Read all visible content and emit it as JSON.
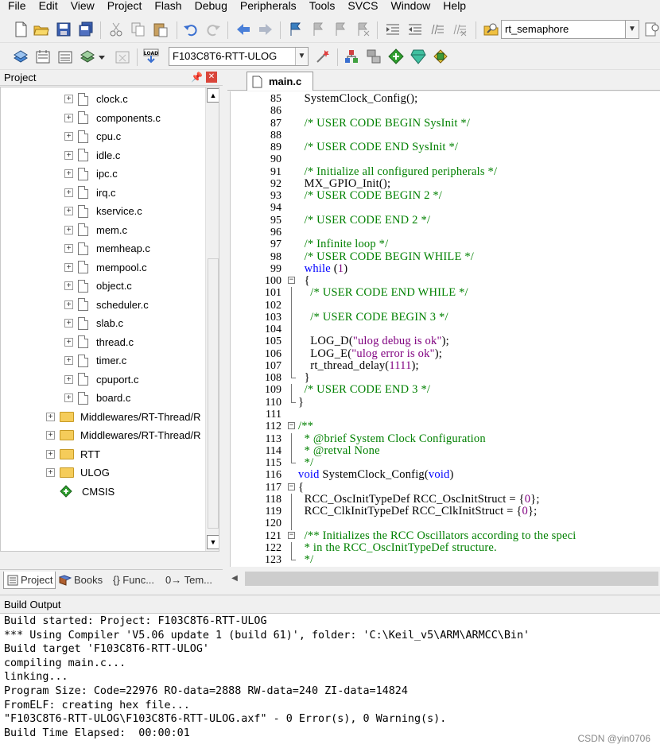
{
  "menu": [
    "File",
    "Edit",
    "View",
    "Project",
    "Flash",
    "Debug",
    "Peripherals",
    "Tools",
    "SVCS",
    "Window",
    "Help"
  ],
  "toolbar1": {
    "find_combo_value": "rt_semaphore",
    "icons": [
      "new-file-icon",
      "open-folder-icon",
      "save-icon",
      "save-all-icon",
      "cut-icon",
      "copy-icon",
      "paste-icon",
      "undo-icon",
      "redo-icon",
      "navigate-back-icon",
      "navigate-forward-icon",
      "bookmark-icon",
      "prev-bookmark-icon",
      "next-bookmark-icon",
      "clear-bookmarks-icon",
      "indent-icon",
      "unindent-icon",
      "comment-icon",
      "uncomment-icon",
      "find-in-files-icon"
    ]
  },
  "toolbar2": {
    "target_combo_value": "F103C8T6-RTT-ULOG",
    "icons": [
      "translate-icon",
      "build-icon",
      "rebuild-icon",
      "batch-build-icon",
      "stop-build-icon",
      "download-icon",
      "target-options-icon",
      "manage-components-icon",
      "select-packs-icon",
      "pack-installer-icon",
      "event-recorder-icon",
      "pack-manager-icon"
    ]
  },
  "project_panel": {
    "title": "Project",
    "files": [
      "clock.c",
      "components.c",
      "cpu.c",
      "idle.c",
      "ipc.c",
      "irq.c",
      "kservice.c",
      "mem.c",
      "memheap.c",
      "mempool.c",
      "object.c",
      "scheduler.c",
      "slab.c",
      "thread.c",
      "timer.c",
      "cpuport.c",
      "board.c"
    ],
    "groups": [
      "Middlewares/RT-Thread/R",
      "Middlewares/RT-Thread/R",
      "RTT",
      "ULOG"
    ],
    "cmsis": "CMSIS",
    "tabs": [
      "Project",
      "Books",
      "{} Func...",
      "0→ Tem..."
    ]
  },
  "editor": {
    "tab_label": "main.c",
    "lines": [
      {
        "n": "85",
        "fold": "",
        "segments": [
          {
            "t": "  SystemClock_Config();",
            "c": "plain"
          }
        ]
      },
      {
        "n": "86",
        "fold": "",
        "segments": []
      },
      {
        "n": "87",
        "fold": "",
        "segments": [
          {
            "t": "  /* USER CODE BEGIN SysInit */",
            "c": "comment"
          }
        ]
      },
      {
        "n": "88",
        "fold": "",
        "segments": []
      },
      {
        "n": "89",
        "fold": "",
        "segments": [
          {
            "t": "  /* USER CODE END SysInit */",
            "c": "comment"
          }
        ]
      },
      {
        "n": "90",
        "fold": "",
        "segments": []
      },
      {
        "n": "91",
        "fold": "",
        "segments": [
          {
            "t": "  /* Initialize all configured peripherals */",
            "c": "comment"
          }
        ]
      },
      {
        "n": "92",
        "fold": "",
        "segments": [
          {
            "t": "  MX_GPIO_Init();",
            "c": "plain"
          }
        ]
      },
      {
        "n": "93",
        "fold": "",
        "segments": [
          {
            "t": "  /* USER CODE BEGIN 2 */",
            "c": "comment"
          }
        ]
      },
      {
        "n": "94",
        "fold": "",
        "segments": []
      },
      {
        "n": "95",
        "fold": "",
        "segments": [
          {
            "t": "  /* USER CODE END 2 */",
            "c": "comment"
          }
        ]
      },
      {
        "n": "96",
        "fold": "",
        "segments": []
      },
      {
        "n": "97",
        "fold": "",
        "segments": [
          {
            "t": "  /* Infinite loop */",
            "c": "comment"
          }
        ]
      },
      {
        "n": "98",
        "fold": "",
        "segments": [
          {
            "t": "  /* USER CODE BEGIN WHILE */",
            "c": "comment"
          }
        ]
      },
      {
        "n": "99",
        "fold": "",
        "segments": [
          {
            "t": "  ",
            "c": "plain"
          },
          {
            "t": "while",
            "c": "keyword"
          },
          {
            "t": " (",
            "c": "plain"
          },
          {
            "t": "1",
            "c": "number"
          },
          {
            "t": ")",
            "c": "plain"
          }
        ]
      },
      {
        "n": "100",
        "fold": "open",
        "segments": [
          {
            "t": "  {",
            "c": "plain"
          }
        ]
      },
      {
        "n": "101",
        "fold": "line",
        "segments": [
          {
            "t": "    /* USER CODE END WHILE */",
            "c": "comment"
          }
        ]
      },
      {
        "n": "102",
        "fold": "line",
        "segments": []
      },
      {
        "n": "103",
        "fold": "line",
        "segments": [
          {
            "t": "    /* USER CODE BEGIN 3 */",
            "c": "comment"
          }
        ]
      },
      {
        "n": "104",
        "fold": "line",
        "segments": []
      },
      {
        "n": "105",
        "fold": "line",
        "segments": [
          {
            "t": "    LOG_D(",
            "c": "plain"
          },
          {
            "t": "\"ulog debug is ok\"",
            "c": "string"
          },
          {
            "t": ");",
            "c": "plain"
          }
        ]
      },
      {
        "n": "106",
        "fold": "line",
        "segments": [
          {
            "t": "    LOG_E(",
            "c": "plain"
          },
          {
            "t": "\"ulog error is ok\"",
            "c": "string"
          },
          {
            "t": ");",
            "c": "plain"
          }
        ]
      },
      {
        "n": "107",
        "fold": "line",
        "segments": [
          {
            "t": "    rt_thread_delay(",
            "c": "plain"
          },
          {
            "t": "1111",
            "c": "number"
          },
          {
            "t": ");",
            "c": "plain"
          }
        ]
      },
      {
        "n": "108",
        "fold": "end",
        "segments": [
          {
            "t": "  }",
            "c": "plain"
          }
        ]
      },
      {
        "n": "109",
        "fold": "line",
        "segments": [
          {
            "t": "  /* USER CODE END 3 */",
            "c": "comment"
          }
        ]
      },
      {
        "n": "110",
        "fold": "end",
        "segments": [
          {
            "t": "}",
            "c": "plain"
          }
        ]
      },
      {
        "n": "111",
        "fold": "",
        "segments": []
      },
      {
        "n": "112",
        "fold": "open",
        "segments": [
          {
            "t": "/**",
            "c": "comment"
          }
        ]
      },
      {
        "n": "113",
        "fold": "line",
        "segments": [
          {
            "t": "  * @brief System Clock Configuration",
            "c": "comment"
          }
        ]
      },
      {
        "n": "114",
        "fold": "line",
        "segments": [
          {
            "t": "  * @retval None",
            "c": "comment"
          }
        ]
      },
      {
        "n": "115",
        "fold": "end",
        "segments": [
          {
            "t": "  */",
            "c": "comment"
          }
        ]
      },
      {
        "n": "116",
        "fold": "",
        "segments": [
          {
            "t": "void",
            "c": "keyword"
          },
          {
            "t": " SystemClock_Config(",
            "c": "plain"
          },
          {
            "t": "void",
            "c": "keyword"
          },
          {
            "t": ")",
            "c": "plain"
          }
        ]
      },
      {
        "n": "117",
        "fold": "open",
        "segments": [
          {
            "t": "{",
            "c": "plain"
          }
        ]
      },
      {
        "n": "118",
        "fold": "line",
        "segments": [
          {
            "t": "  RCC_OscInitTypeDef RCC_OscInitStruct = {",
            "c": "plain"
          },
          {
            "t": "0",
            "c": "number"
          },
          {
            "t": "};",
            "c": "plain"
          }
        ]
      },
      {
        "n": "119",
        "fold": "line",
        "segments": [
          {
            "t": "  RCC_ClkInitTypeDef RCC_ClkInitStruct = {",
            "c": "plain"
          },
          {
            "t": "0",
            "c": "number"
          },
          {
            "t": "};",
            "c": "plain"
          }
        ]
      },
      {
        "n": "120",
        "fold": "line",
        "segments": []
      },
      {
        "n": "121",
        "fold": "open",
        "segments": [
          {
            "t": "  /** Initializes the RCC Oscillators according to the speci",
            "c": "comment"
          }
        ]
      },
      {
        "n": "122",
        "fold": "line",
        "segments": [
          {
            "t": "  * in the RCC_OscInitTypeDef structure.",
            "c": "comment"
          }
        ]
      },
      {
        "n": "123",
        "fold": "end",
        "segments": [
          {
            "t": "  */",
            "c": "comment"
          }
        ]
      }
    ]
  },
  "build_output": {
    "title": "Build Output",
    "lines": [
      "Build started: Project: F103C8T6-RTT-ULOG",
      "*** Using Compiler 'V5.06 update 1 (build 61)', folder: 'C:\\Keil_v5\\ARM\\ARMCC\\Bin'",
      "Build target 'F103C8T6-RTT-ULOG'",
      "compiling main.c...",
      "linking...",
      "Program Size: Code=22976 RO-data=2888 RW-data=240 ZI-data=14824",
      "FromELF: creating hex file...",
      "\"F103C8T6-RTT-ULOG\\F103C8T6-RTT-ULOG.axf\" - 0 Error(s), 0 Warning(s).",
      "Build Time Elapsed:  00:00:01"
    ]
  },
  "watermark": "CSDN @yin0706"
}
